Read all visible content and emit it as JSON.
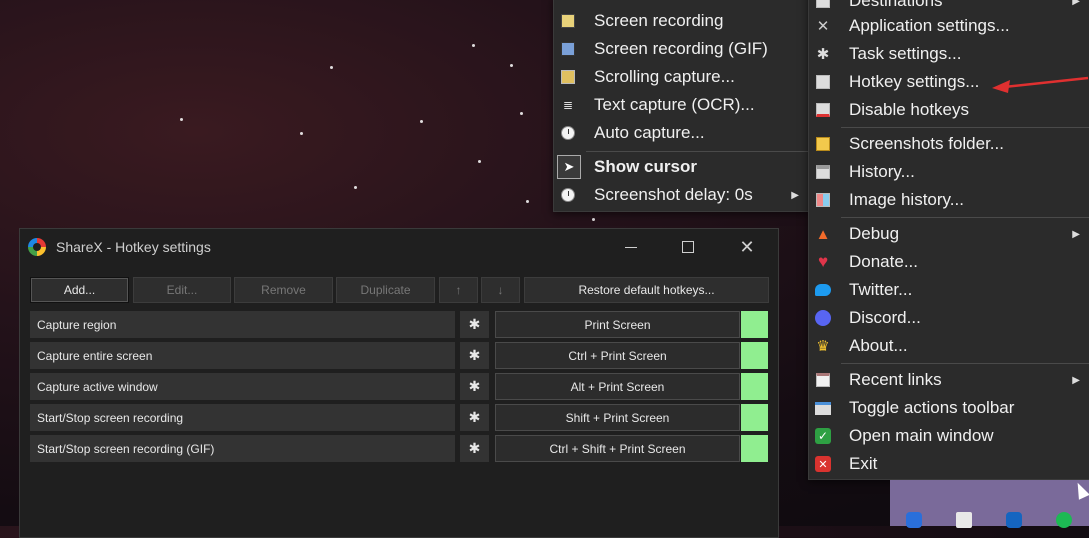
{
  "capture_menu": {
    "items": [
      {
        "label": "Screen recording",
        "icon": "screen-recording-icon"
      },
      {
        "label": "Screen recording (GIF)",
        "icon": "gif-recording-icon"
      },
      {
        "label": "Scrolling capture...",
        "icon": "scrolling-capture-icon"
      },
      {
        "label": "Text capture (OCR)...",
        "icon": "ocr-icon"
      },
      {
        "label": "Auto capture...",
        "icon": "clock-icon"
      },
      {
        "label": "Show cursor",
        "icon": "cursor-icon"
      },
      {
        "label": "Screenshot delay: 0s",
        "icon": "clock-icon"
      }
    ]
  },
  "tray_menu": {
    "items": [
      {
        "label": "Destinations",
        "icon": "destinations-icon"
      },
      {
        "label": "Application settings...",
        "icon": "wrench-icon"
      },
      {
        "label": "Task settings...",
        "icon": "gear-icon"
      },
      {
        "label": "Hotkey settings...",
        "icon": "keyboard-icon"
      },
      {
        "label": "Disable hotkeys",
        "icon": "keyboard-disabled-icon"
      },
      {
        "label": "Screenshots folder...",
        "icon": "folder-icon"
      },
      {
        "label": "History...",
        "icon": "history-icon"
      },
      {
        "label": "Image history...",
        "icon": "image-history-icon"
      },
      {
        "label": "Debug",
        "icon": "debug-cone-icon"
      },
      {
        "label": "Donate...",
        "icon": "heart-icon"
      },
      {
        "label": "Twitter...",
        "icon": "twitter-icon"
      },
      {
        "label": "Discord...",
        "icon": "discord-icon"
      },
      {
        "label": "About...",
        "icon": "crown-icon"
      },
      {
        "label": "Recent links",
        "icon": "clipboard-icon"
      },
      {
        "label": "Toggle actions toolbar",
        "icon": "toolbar-icon"
      },
      {
        "label": "Open main window",
        "icon": "check-icon"
      },
      {
        "label": "Exit",
        "icon": "exit-icon"
      }
    ]
  },
  "window": {
    "title": "ShareX - Hotkey settings",
    "toolbar": {
      "add": "Add...",
      "edit": "Edit...",
      "remove": "Remove",
      "duplicate": "Duplicate",
      "up": "↑",
      "down": "↓",
      "restore": "Restore default hotkeys..."
    },
    "hotkeys": [
      {
        "task": "Capture region",
        "keys": "Print Screen"
      },
      {
        "task": "Capture entire screen",
        "keys": "Ctrl + Print Screen"
      },
      {
        "task": "Capture active window",
        "keys": "Alt + Print Screen"
      },
      {
        "task": "Start/Stop screen recording",
        "keys": "Shift + Print Screen"
      },
      {
        "task": "Start/Stop screen recording (GIF)",
        "keys": "Ctrl + Shift + Print Screen"
      }
    ]
  },
  "colors": {
    "hotkey_status_ok": "#90ee90",
    "annotation_arrow": "#e03030",
    "menu_background": "#2b2b2b"
  }
}
